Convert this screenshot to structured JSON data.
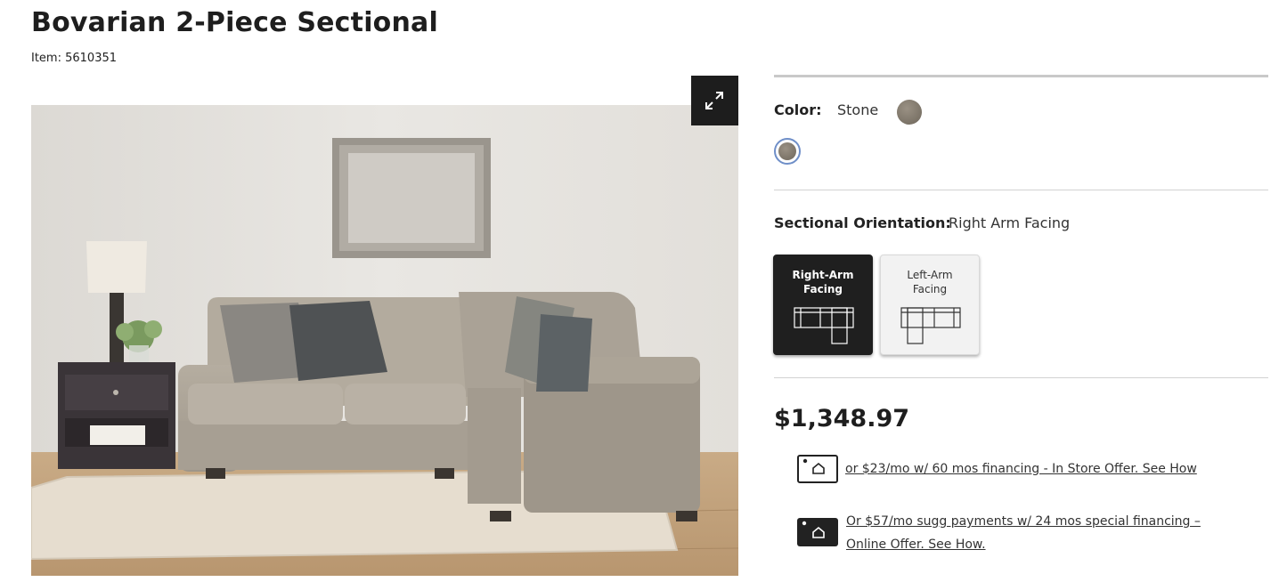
{
  "product": {
    "title": "Bovarian 2-Piece Sectional",
    "item_number": "Item: 5610351"
  },
  "image": {
    "alt": "Product photo",
    "expand_icon": "expand-arrows-icon"
  },
  "color": {
    "label": "Color:",
    "value": "Stone",
    "swatch_color": "#857d71"
  },
  "orientation": {
    "label": "Sectional Orientation:",
    "value": "Right Arm Facing",
    "options": [
      {
        "label_line1": "Right-Arm",
        "label_line2": "Facing",
        "selected": true
      },
      {
        "label_line1": "Left-Arm",
        "label_line2": "Facing",
        "selected": false
      }
    ]
  },
  "price": "$1,348.97",
  "financing": [
    {
      "text": "or $23/mo w/ 60 mos financing - In Store Offer. See How",
      "icon": "store-card-icon"
    },
    {
      "text": "Or $57/mo sugg payments w/ 24 mos special financing – Online Offer. See How.",
      "icon": "online-card-icon"
    }
  ],
  "colors": {
    "dark": "#1f1f1f",
    "swatch_ring": "#6f8fc8",
    "rule": "#d2d2d2"
  }
}
